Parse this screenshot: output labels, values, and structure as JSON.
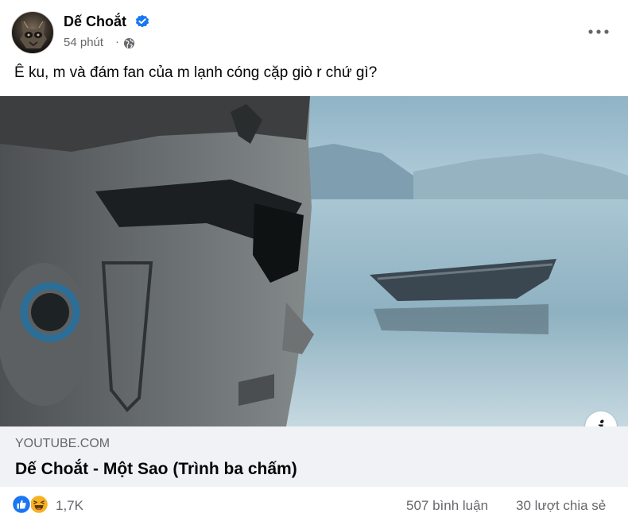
{
  "post": {
    "author": "Dế Choắt",
    "time": "54 phút",
    "separator": "·",
    "privacy_icon": "globe-icon",
    "verified_icon": "verified-badge-icon",
    "more_icon": "more-options-icon",
    "text": "Ê ku, m và đám fan của m lạnh cóng cặp giò r chứ gì?"
  },
  "link": {
    "domain": "YOUTUBE.COM",
    "title": "Dế Choắt - Một Sao (Trình ba chấm)",
    "info_label": "i"
  },
  "footer": {
    "reactions": [
      "like-reaction-icon",
      "haha-reaction-icon"
    ],
    "reaction_count": "1,7K",
    "comments": "507 bình luận",
    "shares": "30 lượt chia sẻ"
  },
  "colors": {
    "accent": "#1877f2",
    "secondary_text": "#65676b",
    "preview_bg": "#f0f2f5",
    "haha": "#f7b125"
  }
}
